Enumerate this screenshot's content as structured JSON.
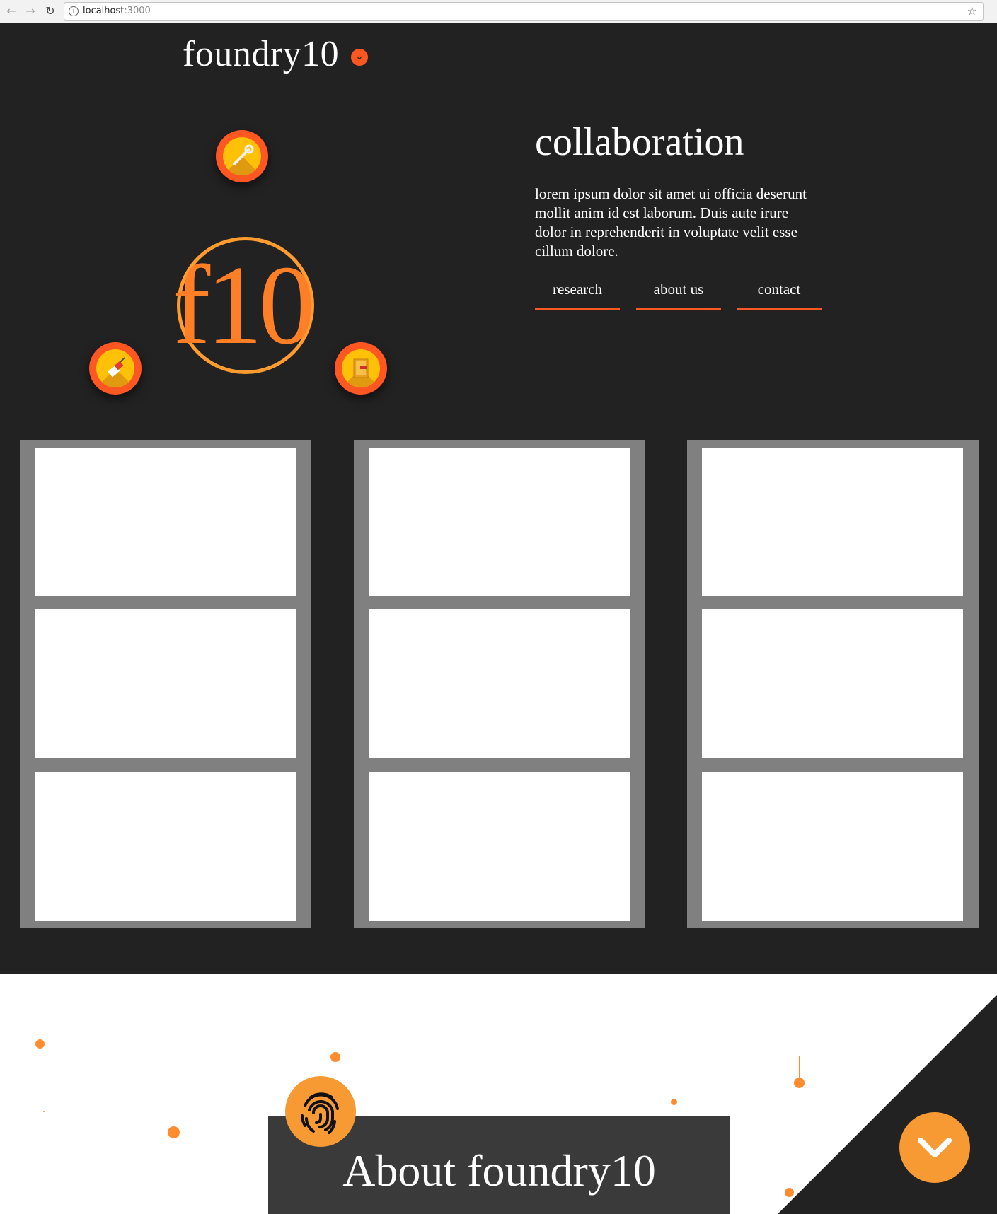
{
  "browser": {
    "url_host": "localhost",
    "url_port": ":3000",
    "info_icon": "info-icon",
    "star_icon": "bookmark-star-icon"
  },
  "header": {
    "brand": "foundry10",
    "menu_icon": "chevron-down-icon"
  },
  "hero": {
    "logo_text": "f10",
    "badges": [
      "wrench-icon",
      "paint-brush-icon",
      "book-icon"
    ],
    "headline": "collaboration",
    "blurb": "lorem ipsum dolor sit amet ui officia deserunt mollit anim id est laborum. Duis aute irure dolor in reprehenderit in voluptate velit esse cillum dolore.",
    "links": [
      "research",
      "about us",
      "contact"
    ]
  },
  "colors": {
    "accent": "#ff5722",
    "orange": "#ff8c2e",
    "dark": "#222222",
    "grid": "#808080"
  },
  "about": {
    "title": "About foundry10",
    "icon": "fingerprint-icon",
    "fab_icon": "chevron-down-icon"
  }
}
